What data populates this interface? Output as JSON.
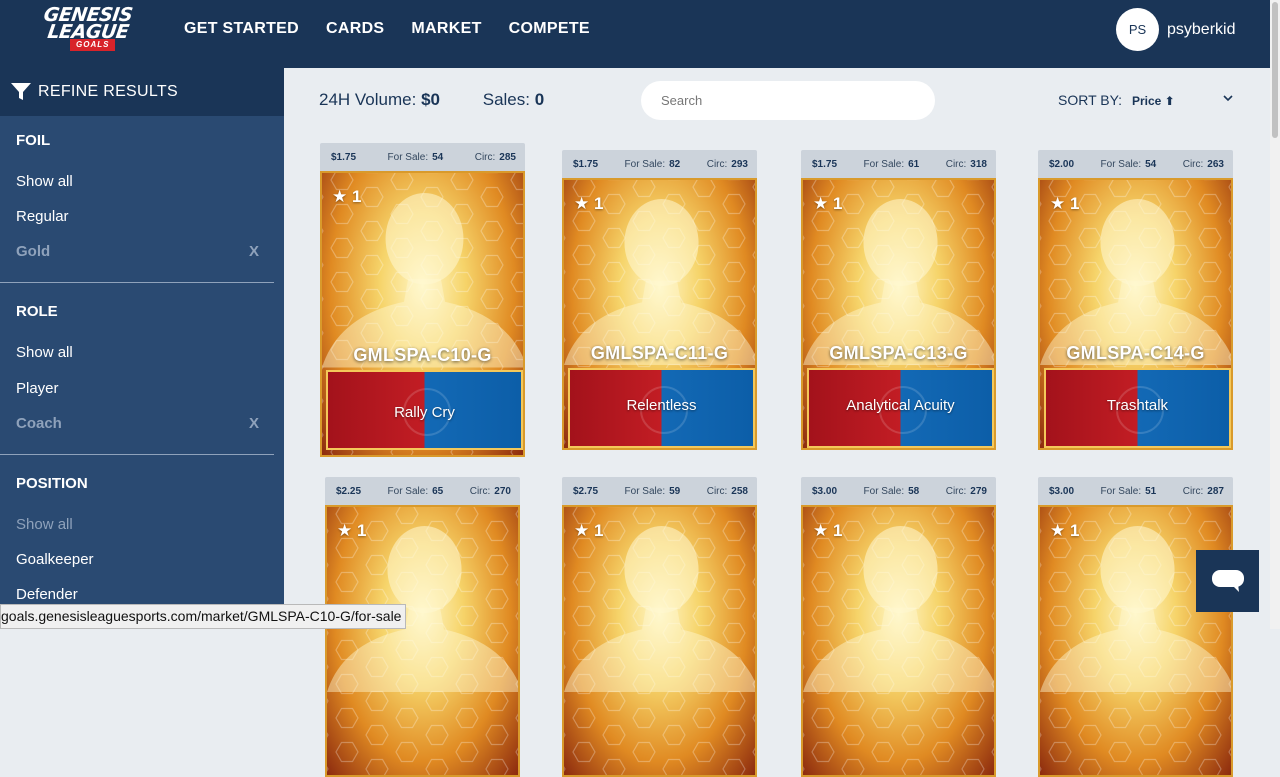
{
  "brand": {
    "line1": "GENESIS",
    "line2": "LEAGUE",
    "line3": "GOALS"
  },
  "nav": [
    "GET STARTED",
    "CARDS",
    "MARKET",
    "COMPETE"
  ],
  "user": {
    "initials": "PS",
    "name": "psyberkid"
  },
  "sidebar": {
    "refine_label": "REFINE RESULTS",
    "foil": {
      "title": "FOIL",
      "options": [
        "Show all",
        "Regular",
        "Gold"
      ],
      "clear": "X"
    },
    "role": {
      "title": "ROLE",
      "options": [
        "Show all",
        "Player",
        "Coach"
      ],
      "clear": "X"
    },
    "position": {
      "title": "POSITION",
      "options": [
        "Show all",
        "Goalkeeper",
        "Defender"
      ]
    }
  },
  "stats": {
    "volume_label": "24H Volume:",
    "volume_value": "$0",
    "sales_label": "Sales:",
    "sales_value": "0"
  },
  "search": {
    "placeholder": "Search"
  },
  "sort": {
    "label": "SORT BY:",
    "value": "Price ⬆"
  },
  "card_labels": {
    "for_sale": "For Sale:",
    "circ": "Circ:"
  },
  "cards": [
    {
      "price": "$1.75",
      "for_sale": "54",
      "circ": "285",
      "stars": "★ 1",
      "code": "GMLSPA-C10-G",
      "name": "Rally Cry"
    },
    {
      "price": "$1.75",
      "for_sale": "82",
      "circ": "293",
      "stars": "★ 1",
      "code": "GMLSPA-C11-G",
      "name": "Relentless"
    },
    {
      "price": "$1.75",
      "for_sale": "61",
      "circ": "318",
      "stars": "★ 1",
      "code": "GMLSPA-C13-G",
      "name": "Analytical Acuity"
    },
    {
      "price": "$2.00",
      "for_sale": "54",
      "circ": "263",
      "stars": "★ 1",
      "code": "GMLSPA-C14-G",
      "name": "Trashtalk"
    },
    {
      "price": "$2.25",
      "for_sale": "65",
      "circ": "270",
      "stars": "★ 1"
    },
    {
      "price": "$2.75",
      "for_sale": "59",
      "circ": "258",
      "stars": "★ 1"
    },
    {
      "price": "$3.00",
      "for_sale": "58",
      "circ": "279",
      "stars": "★ 1"
    },
    {
      "price": "$3.00",
      "for_sale": "51",
      "circ": "287",
      "stars": "★ 1"
    }
  ],
  "status_url": "goals.genesisleaguesports.com/market/GMLSPA-C10-G/for-sale",
  "icons": {
    "filter": "filter-icon",
    "chevron": "chevron-down-icon",
    "chat": "chat-icon"
  },
  "colors": {
    "nav_bg": "#1a3557",
    "sidebar_bg": "#2a4a72",
    "banner_red": "#c21d24",
    "banner_blue": "#1369b5"
  }
}
